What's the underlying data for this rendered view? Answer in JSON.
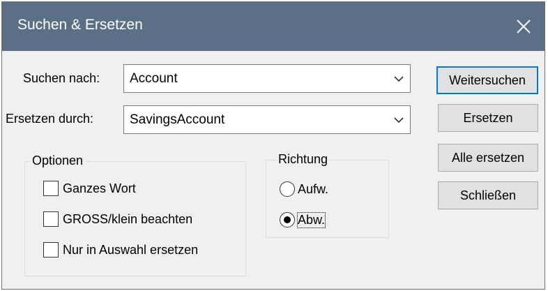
{
  "dialog": {
    "title": "Suchen & Ersetzen",
    "close_icon": "close-icon"
  },
  "search": {
    "label": "Suchen nach:",
    "value": "Account"
  },
  "replace": {
    "label": "Ersetzen durch:",
    "value": "SavingsAccount"
  },
  "buttons": {
    "find_next": "Weitersuchen",
    "replace": "Ersetzen",
    "replace_all": "Alle ersetzen",
    "close": "Schließen"
  },
  "options": {
    "legend": "Optionen",
    "items": [
      {
        "label": "Ganzes Wort",
        "checked": false
      },
      {
        "label": "GROSS/klein beachten",
        "checked": false
      },
      {
        "label": "Nur in Auswahl ersetzen",
        "checked": false
      }
    ]
  },
  "direction": {
    "legend": "Richtung",
    "items": [
      {
        "label": "Aufw.",
        "selected": false
      },
      {
        "label": "Abw.",
        "selected": true
      }
    ]
  },
  "colors": {
    "titlebar": "#5b7086",
    "dialog_bg": "#f0f0f0",
    "default_button_border": "#0078d7"
  }
}
